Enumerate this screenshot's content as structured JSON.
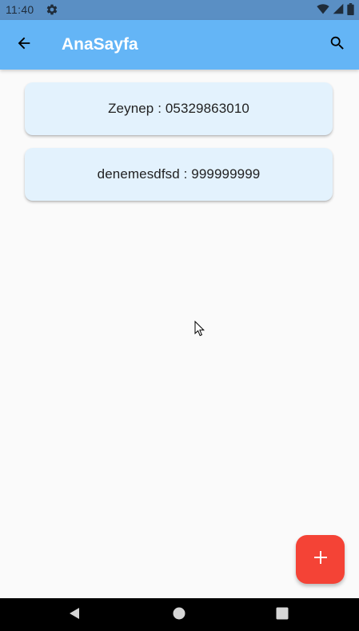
{
  "status_bar": {
    "time": "11:40",
    "background": "#5a8fc4",
    "icons": [
      "settings-icon",
      "wifi-icon",
      "signal-icon",
      "battery-icon"
    ]
  },
  "app_bar": {
    "title": "AnaSayfa",
    "background": "#64b5f6",
    "leading_icon": "arrow-back-icon",
    "trailing_icon": "search-icon"
  },
  "contacts": [
    {
      "name": "Zeynep",
      "phone": "05329863010",
      "display": "Zeynep : 05329863010"
    },
    {
      "name": "denemesdfsd",
      "phone": "999999999",
      "display": "denemesdfsd : 999999999"
    }
  ],
  "card_background": "#e3f2fd",
  "fab": {
    "icon": "add-icon",
    "background": "#f44336"
  },
  "nav_bar": {
    "buttons": [
      "nav-back-icon",
      "nav-home-icon",
      "nav-recents-icon"
    ]
  }
}
